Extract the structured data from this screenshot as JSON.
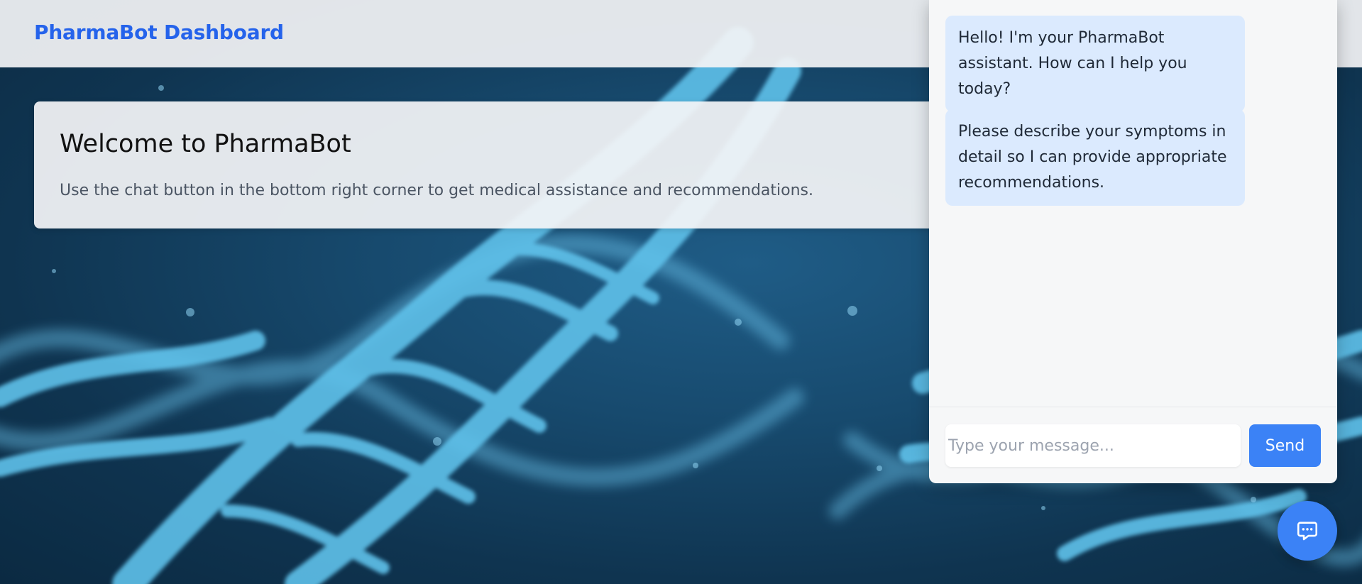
{
  "header": {
    "brand": "PharmaBot Dashboard"
  },
  "welcome": {
    "title": "Welcome to PharmaBot",
    "text": "Use the chat button in the bottom right corner to get medical assistance and recommendations."
  },
  "chat": {
    "messages": [
      {
        "sender": "bot",
        "text": "Hello! I'm your PharmaBot assistant. How can I help you today?"
      },
      {
        "sender": "bot",
        "text": "Please describe your symptoms in detail so I can provide appropriate recommendations."
      }
    ],
    "input": {
      "value": "",
      "placeholder": "Type your message..."
    },
    "send_label": "Send",
    "toggle_icon": "chat-bubble-icon"
  },
  "colors": {
    "accent": "#3b82f6",
    "brand": "#2563eb",
    "bubble": "#dbeafe",
    "background": "#174a6e"
  }
}
